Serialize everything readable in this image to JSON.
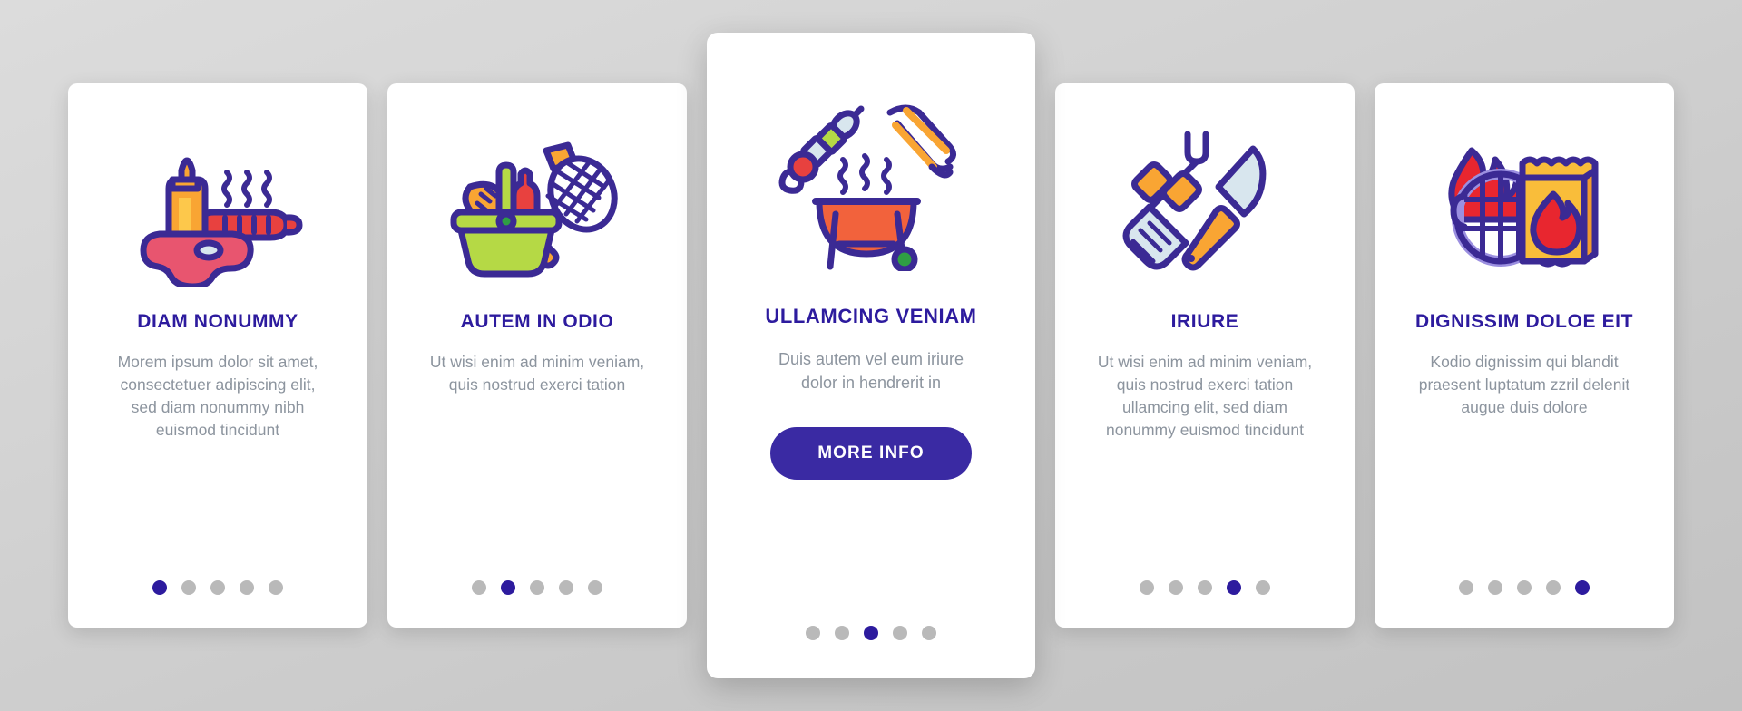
{
  "theme": {
    "primary": "#2d1b9e",
    "button": "#3a2aa3",
    "body_text": "#8c949e",
    "dot_inactive": "#b9b9b9",
    "card_bg": "#ffffff",
    "page_bg": "#d3d3d3"
  },
  "carousel": {
    "total_slides": 5,
    "cards": [
      {
        "icon_name": "steak-sausage-mustard-icon",
        "title": "DIAM NONUMMY",
        "body": "Morem ipsum dolor sit amet, consectetuer adipiscing elit, sed diam nonummy nibh euismod tincidunt",
        "active_dot": 1,
        "featured": false,
        "button_label": ""
      },
      {
        "icon_name": "picnic-basket-racket-icon",
        "title": "AUTEM IN ODIO",
        "body": "Ut wisi enim ad minim veniam, quis nostrud exerci tation",
        "active_dot": 2,
        "featured": false,
        "button_label": ""
      },
      {
        "icon_name": "bbq-grill-skewer-tongs-icon",
        "title": "ULLAMCING VENIAM",
        "body": "Duis autem vel eum iriure dolor in hendrerit in",
        "active_dot": 3,
        "featured": true,
        "button_label": "MORE INFO"
      },
      {
        "icon_name": "spatula-fork-knife-icon",
        "title": "IRIURE",
        "body": "Ut wisi enim ad minim veniam, quis nostrud exerci tation ullamcing elit, sed diam nonummy euismod tincidunt",
        "active_dot": 4,
        "featured": false,
        "button_label": ""
      },
      {
        "icon_name": "charcoal-bag-flame-grill-icon",
        "title": "DIGNISSIM DOLOE EIT",
        "body": "Kodio dignissim qui blandit praesent luptatum zzril delenit augue duis dolore",
        "active_dot": 5,
        "featured": false,
        "button_label": ""
      }
    ]
  }
}
